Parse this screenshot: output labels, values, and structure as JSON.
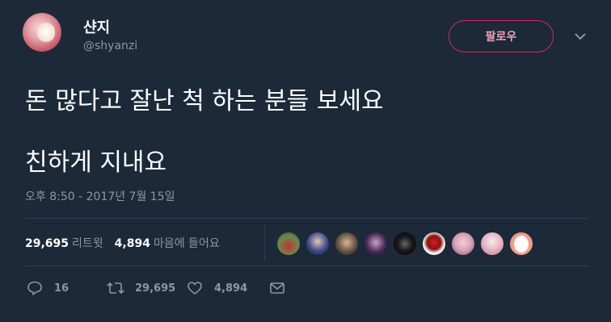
{
  "user": {
    "display_name": "샨지",
    "handle": "@shyanzi"
  },
  "follow_button": {
    "label": "팔로우"
  },
  "tweet": {
    "lines": [
      "돈 많다고 잘난 척 하는 분들 보세요",
      "친하게 지내요"
    ],
    "timestamp": "오후 8:50 - 2017년 7월 15일"
  },
  "stats": {
    "retweets_count": "29,695",
    "retweets_label": "리트윗",
    "likes_count": "4,894",
    "likes_label": "마음에 들어요"
  },
  "liker_avatars": [
    "avatar-1",
    "avatar-2",
    "avatar-3",
    "avatar-4",
    "avatar-5",
    "avatar-6",
    "avatar-7",
    "avatar-8",
    "avatar-9"
  ],
  "actions": {
    "reply_count": "16",
    "retweet_count": "29,695",
    "like_count": "4,894"
  },
  "icons": [
    "chevron-down-icon",
    "reply-icon",
    "retweet-icon",
    "heart-icon",
    "message-icon"
  ],
  "colors": {
    "background": "#1c2938",
    "secondary_text": "#8899a6",
    "follow_border": "#e0245e"
  }
}
